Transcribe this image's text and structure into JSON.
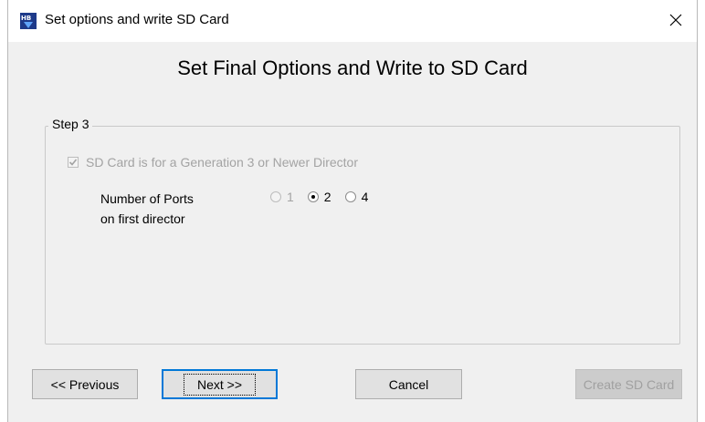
{
  "window": {
    "title": "Set options and write SD Card",
    "icon": "hb-app-icon",
    "close_glyph": "✕"
  },
  "heading": "Set Final Options and Write to SD Card",
  "step_group": {
    "label": "Step 3",
    "checkbox": {
      "label": "SD Card is for a Generation 3 or Newer Director",
      "checked": true,
      "enabled": false
    },
    "ports": {
      "label_line1": "Number of Ports",
      "label_line2": "on first director",
      "options": [
        {
          "label": "1",
          "selected": false,
          "enabled": false
        },
        {
          "label": "2",
          "selected": true,
          "enabled": true
        },
        {
          "label": "4",
          "selected": false,
          "enabled": true
        }
      ]
    }
  },
  "buttons": {
    "previous": "<< Previous",
    "next": ">>",
    "next_text": "Next",
    "cancel": "Cancel",
    "create": "Create SD Card"
  }
}
